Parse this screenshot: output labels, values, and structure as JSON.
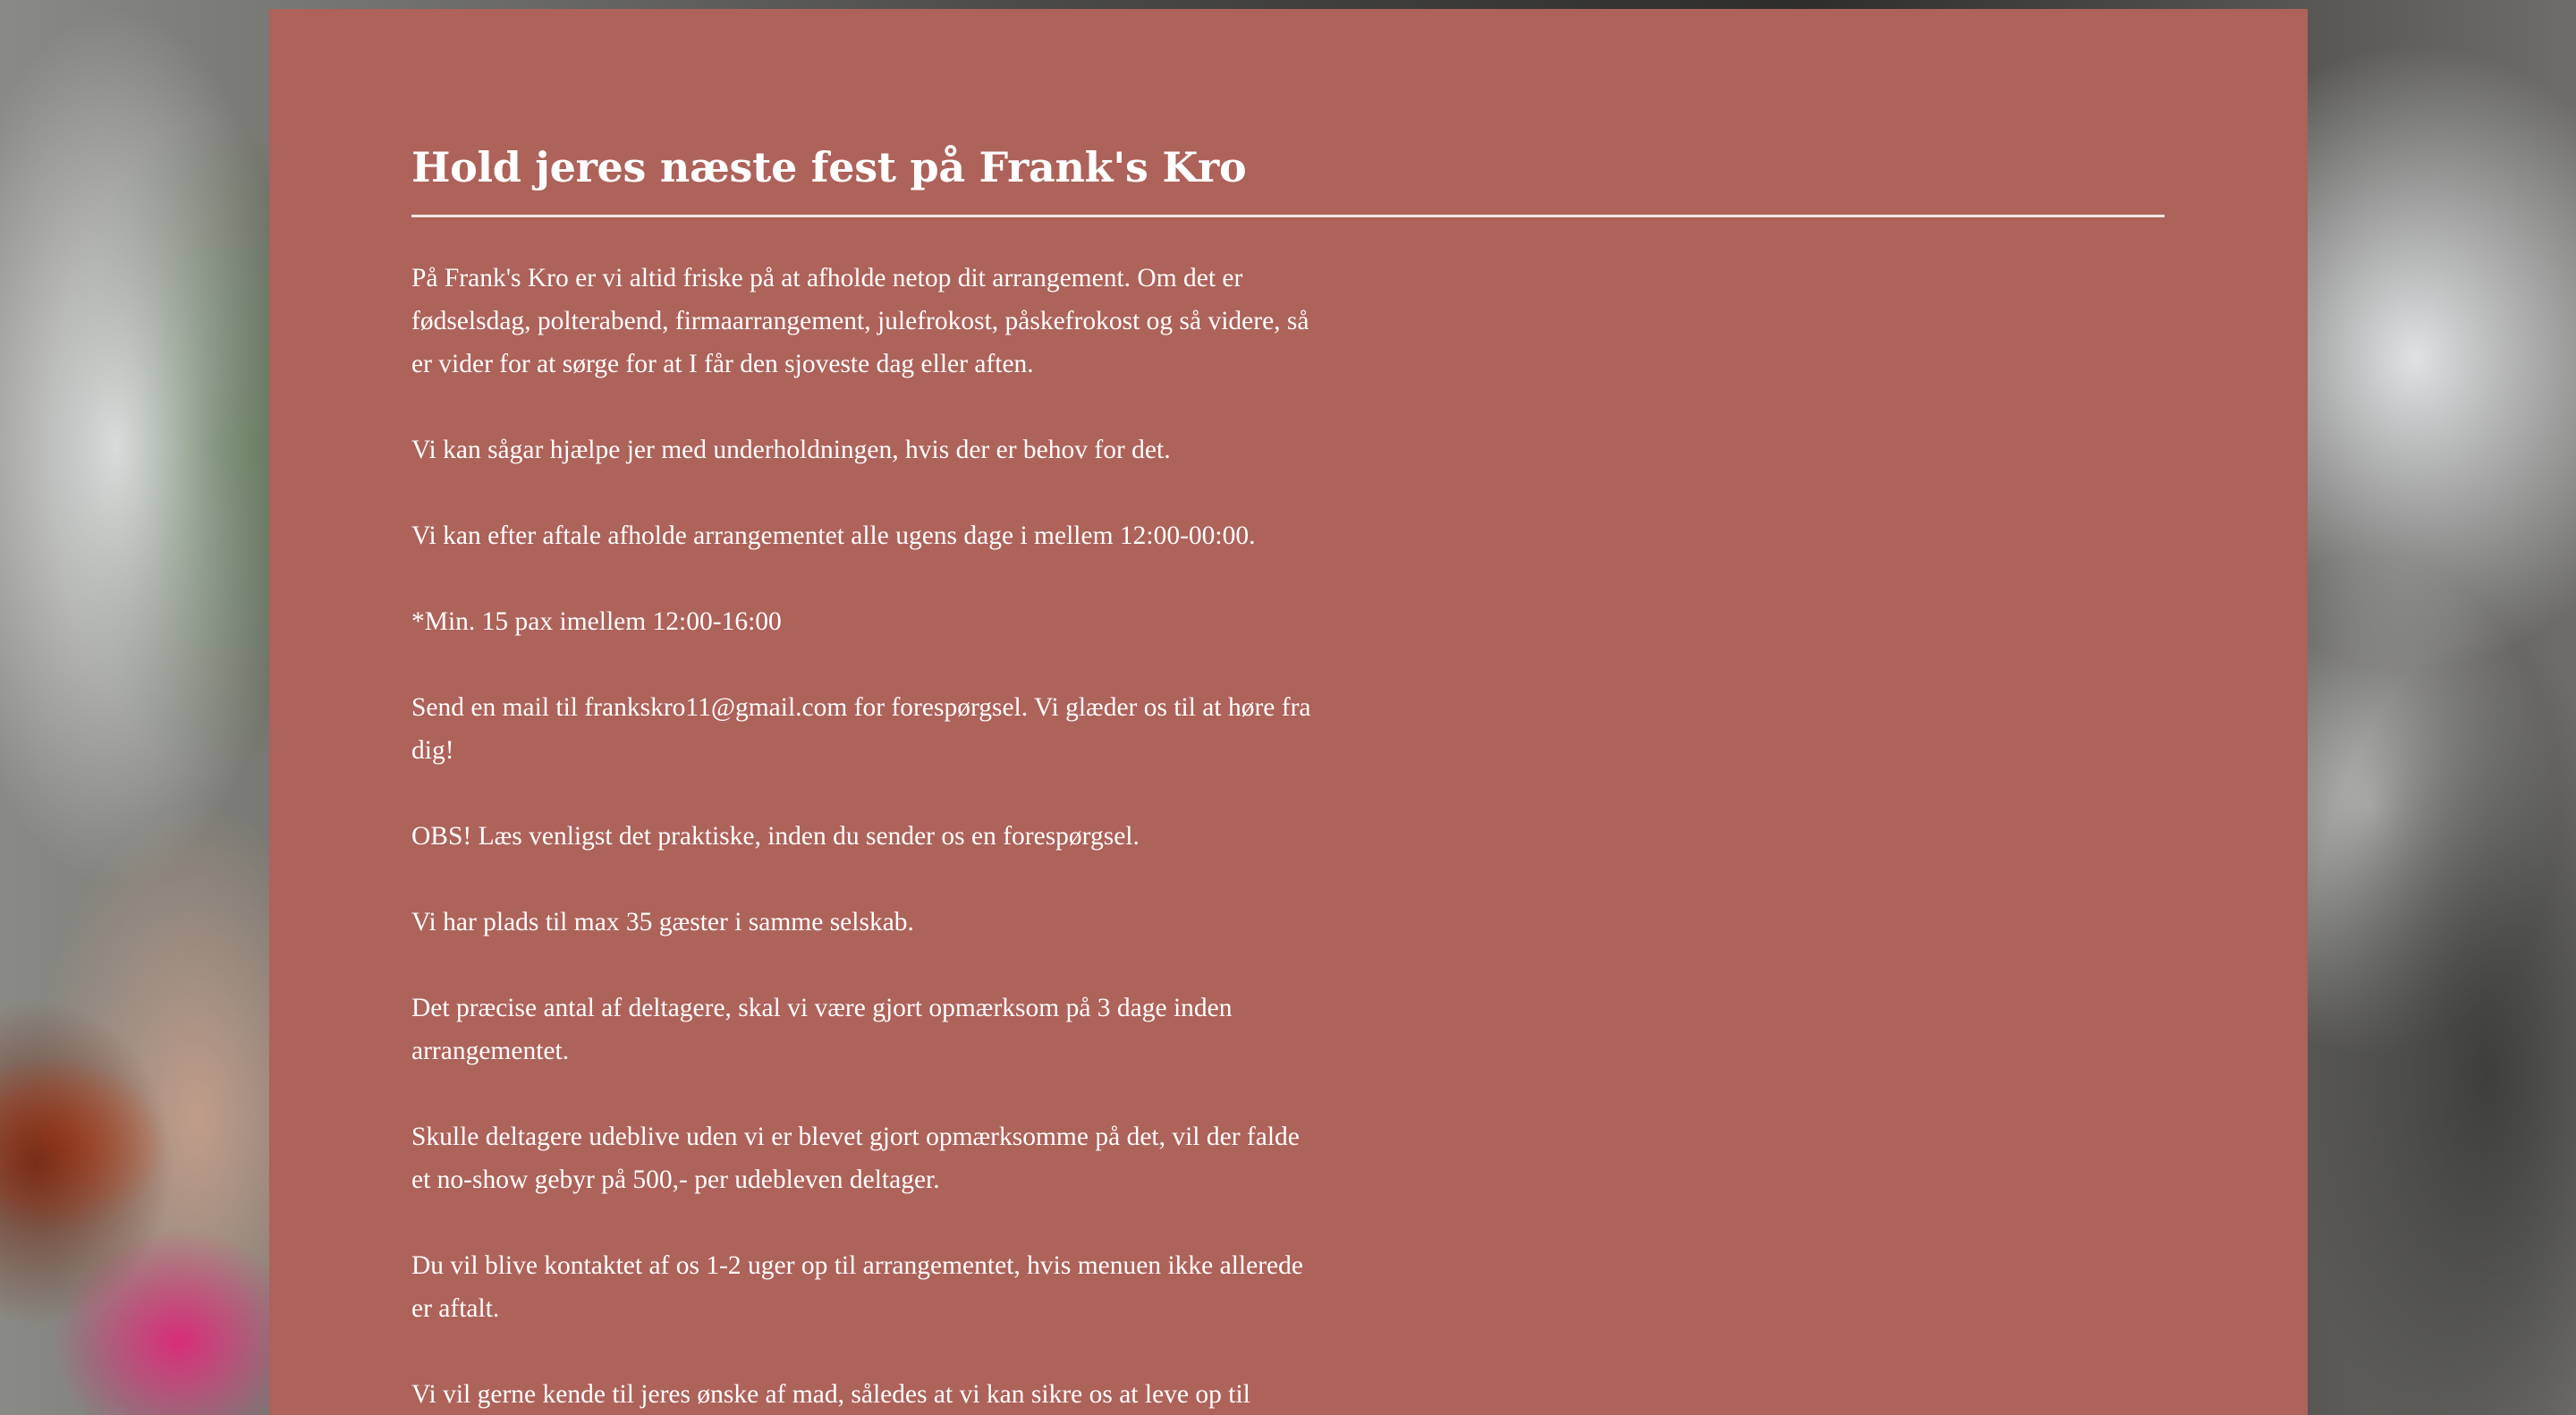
{
  "page": {
    "title": "Hold jeres næste fest på Frank's Kro",
    "paragraphs": [
      "På Frank's Kro er vi altid friske på at afholde netop dit arrangement. Om det er fødselsdag, polterabend, firmaarrangement, julefrokost, påskefrokost og så videre, så er vider for at sørge for at I får den sjoveste dag eller aften.",
      "Vi kan sågar hjælpe jer med underholdningen, hvis der er behov for det.",
      "Vi kan efter aftale afholde arrangementet alle ugens dage i mellem 12:00-00:00.",
      "*Min. 15 pax imellem 12:00-16:00",
      "Send en mail til frankskro11@gmail.com for forespørgsel. Vi glæder os til at høre fra dig!",
      "OBS! Læs venligst det praktiske, inden du sender os en forespørgsel.",
      "Vi har plads til max 35 gæster i samme selskab.",
      "Det præcise antal af deltagere, skal vi være gjort opmærksom på 3 dage inden arrangementet.",
      "Skulle deltagere udeblive uden vi er blevet gjort opmærksomme på det, vil der falde et no-show gebyr på 500,- per udebleven deltager.",
      "Du vil blive kontaktet af os 1-2 uger op til arrangementet, hvis menuen ikke allerede er aftalt.",
      "Vi vil gerne kende til jeres ønske af mad, således at vi kan sikre os at leve op til"
    ]
  },
  "colors": {
    "panel_background": "#ad625a",
    "text": "#ffffff",
    "divider": "#f2e6e4"
  }
}
